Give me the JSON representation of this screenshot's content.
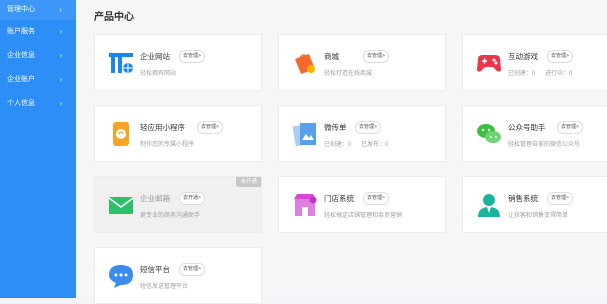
{
  "sidebar": {
    "items": [
      {
        "label": "管理中心"
      },
      {
        "label": "账户服务"
      },
      {
        "label": "企业信息"
      },
      {
        "label": "企业账户"
      },
      {
        "label": "个人信息"
      }
    ]
  },
  "main": {
    "title": "产品中心",
    "cards": [
      {
        "title": "企业网站",
        "manage": "去管理>",
        "desc": "轻松拥有网站"
      },
      {
        "title": "商城",
        "manage": "去管理>",
        "desc": "轻松打造在线商城"
      },
      {
        "title": "互动游戏",
        "manage": "去管理>",
        "stats": [
          "已创建：0",
          "进行中：0"
        ]
      },
      {
        "title": "轻应用小程序",
        "manage": "去管理>",
        "desc": "制作您的专属小程序"
      },
      {
        "title": "微传单",
        "manage": "去管理>",
        "stats": [
          "已创建：0",
          "已发布：0"
        ]
      },
      {
        "title": "公众号助手",
        "manage": "去管理>",
        "desc": "轻松管理自家的微信公众号"
      },
      {
        "title": "企业邮箱",
        "manage": "去开通>",
        "desc": "更专业的商务沟通助手",
        "tag": "未开通"
      },
      {
        "title": "门店系统",
        "manage": "去管理>",
        "desc": "轻松搞定店铺管理和会员营销"
      },
      {
        "title": "销售系统",
        "manage": "去管理>",
        "desc": "让获客和销售变得简单"
      },
      {
        "title": "短信平台",
        "manage": "去管理>",
        "desc": "短信发送管理平台"
      }
    ]
  },
  "icons": {
    "website": "website-icon",
    "mall": "shopping-bag-icon",
    "game": "gamepad-icon",
    "miniapp": "mini-program-icon",
    "flyer": "flyer-icon",
    "wechat": "wechat-icon",
    "mail": "mail-icon",
    "store": "store-icon",
    "sales": "sales-person-icon",
    "sms": "chat-bubble-icon"
  },
  "colors": {
    "sidebar": "#2d8ef7",
    "website": "#1a86e8",
    "mall": "#f56a2c",
    "game": "#e8374a",
    "miniapp": "#f5a623",
    "flyer": "#5aa0e8",
    "wechat": "#3cbf3c",
    "mail": "#2fbf6a",
    "store": "#d44ad6",
    "sales": "#1bb39c",
    "sms": "#3a8cef"
  }
}
